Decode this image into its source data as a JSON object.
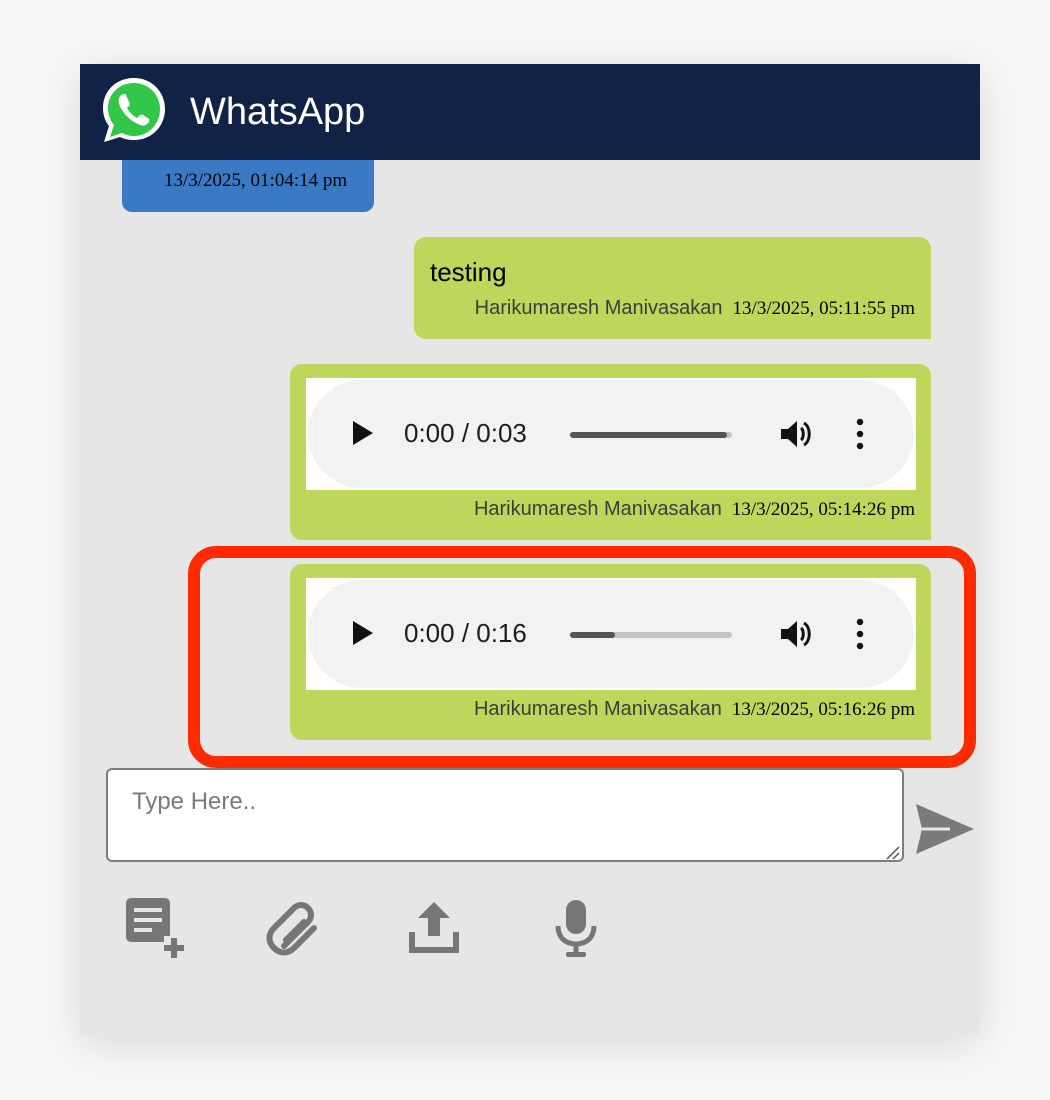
{
  "header": {
    "title": "WhatsApp"
  },
  "messages": [
    {
      "type": "text",
      "timestamp": "13/3/2025, 01:04:14 pm"
    },
    {
      "type": "text",
      "text": "testing",
      "sender": "Harikumaresh Manivasakan",
      "timestamp": "13/3/2025, 05:11:55 pm"
    },
    {
      "type": "audio",
      "time_display": "0:00 / 0:03",
      "progress": 0.97,
      "sender": "Harikumaresh Manivasakan",
      "timestamp": "13/3/2025, 05:14:26 pm"
    },
    {
      "type": "audio",
      "time_display": "0:00 / 0:16",
      "progress": 0.28,
      "sender": "Harikumaresh Manivasakan",
      "timestamp": "13/3/2025, 05:16:26 pm"
    }
  ],
  "composer": {
    "placeholder": "Type Here.."
  },
  "icons": {
    "logo": "whatsapp-logo",
    "send": "send-icon",
    "tools": [
      "note-add-icon",
      "attach-icon",
      "upload-icon",
      "mic-icon"
    ]
  },
  "colors": {
    "header": "#102245",
    "bubble_outgoing": "#bcd75a",
    "bubble_incoming": "#3a7ac4",
    "highlight": "#ff2a00",
    "icon_gray": "#767676"
  }
}
